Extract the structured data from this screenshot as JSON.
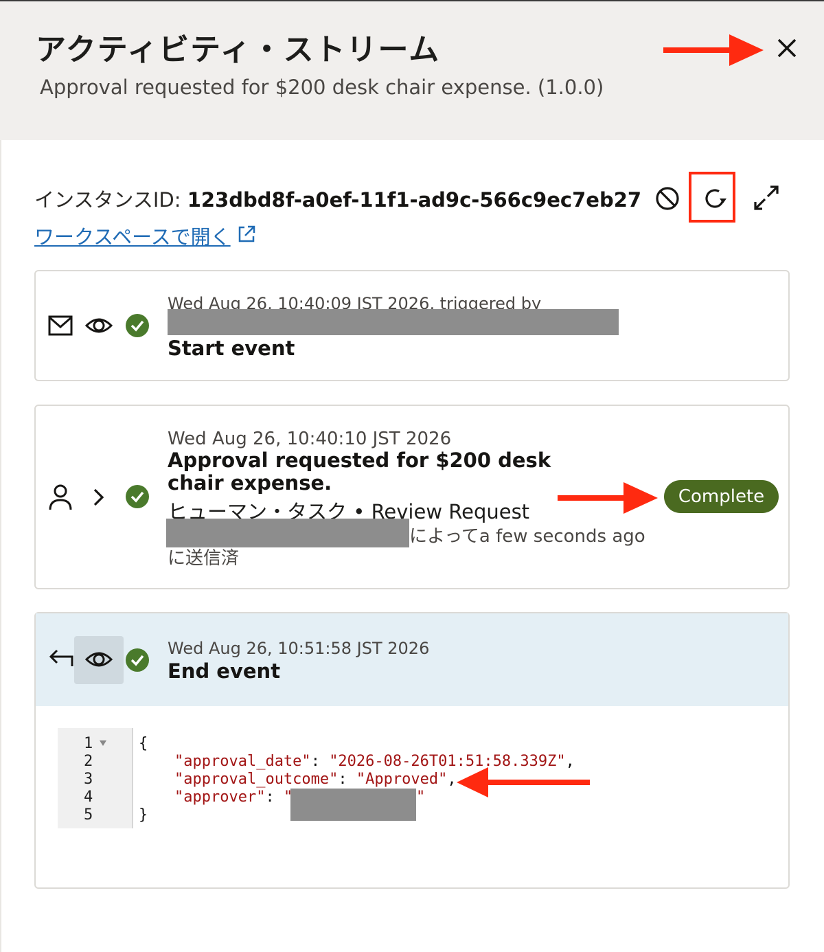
{
  "header": {
    "title": "アクティビティ・ストリーム",
    "subtitle": "Approval requested for $200 desk chair expense. (1.0.0)"
  },
  "instance": {
    "label": "インスタンスID: ",
    "id": "123dbd8f-a0ef-11f1-ad9c-566c9ec7eb27",
    "open_workspace": "ワークスペースで開く"
  },
  "events": [
    {
      "timestamp": "Wed Aug 26, 10:40:09 JST 2026, triggered by",
      "title": "Start event"
    },
    {
      "timestamp": "Wed Aug 26, 10:40:10 JST 2026",
      "title": "Approval requested for $200 desk chair expense.",
      "task_type": "ヒューマン・タスク",
      "task_name": "Review Request",
      "by_suffix": "によってa few seconds ago",
      "sent": "に送信済",
      "status": "Complete"
    },
    {
      "timestamp": "Wed Aug 26, 10:51:58 JST 2026",
      "title": "End event"
    }
  ],
  "payload": {
    "line_numbers": [
      "1",
      "2",
      "3",
      "4",
      "5"
    ],
    "open_brace": "{",
    "close_brace": "}",
    "key1": "\"approval_date\"",
    "val1": "\"2026-08-26T01:51:58.339Z\"",
    "key2": "\"approval_outcome\"",
    "val2": "\"Approved\"",
    "key3": "\"approver\"",
    "val3_open": "\"",
    "val3_close": "\""
  },
  "colors": {
    "accent_annotation": "#ff2a10",
    "status_complete": "#4a6a20",
    "check_green": "#4a7a2c",
    "link": "#1f6bb5"
  },
  "icons": [
    "close-icon",
    "cancel-icon",
    "refresh-icon",
    "expand-icon",
    "external-link-icon",
    "mail-icon",
    "eye-icon",
    "check-circle-icon",
    "person-icon",
    "chevron-right-icon",
    "return-arrow-icon"
  ]
}
